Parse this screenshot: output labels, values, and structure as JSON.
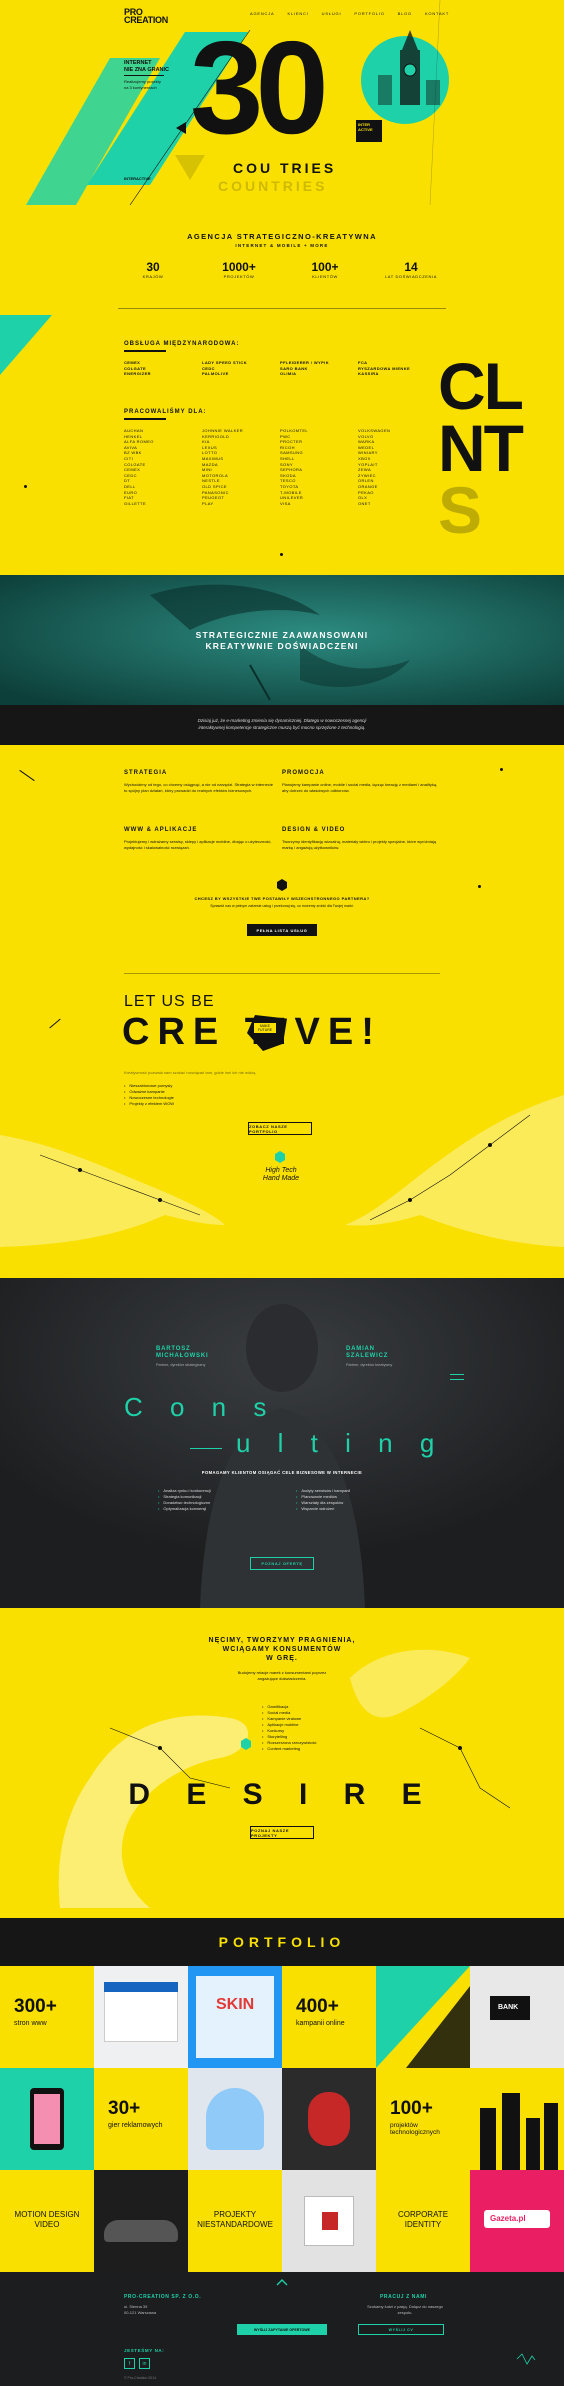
{
  "brand": {
    "logo_line1": "PRO",
    "logo_line2": "CREATION"
  },
  "nav": {
    "items": [
      "AGENCJA",
      "KLIENCI",
      "USŁUGI",
      "PORTFOLIO",
      "BLOG",
      "KONTAKT"
    ]
  },
  "hero": {
    "tagline_title_1": "INTERNET",
    "tagline_title_2": "NIE ZNA GRANIC",
    "tagline_text_1": "Realizujemy projekty",
    "tagline_text_2": "na 3 kontynentach",
    "big_number": "30",
    "word_top": "COU   TRIES",
    "word_bottom": "COUNTRIES",
    "word_rest": "NTRIES",
    "side_label": "INTERACTIVE",
    "badge": "INTER ACTIVE"
  },
  "stats": {
    "title": "AGENCJA STRATEGICZNO-KREATYWNA",
    "subtitle": "INTERNET & MOBILE + MORE",
    "items": [
      {
        "value": "30",
        "label": "KRAJÓW"
      },
      {
        "value": "1000+",
        "label": "PROJEKTÓW"
      },
      {
        "value": "100+",
        "label": "KLIENTÓW"
      },
      {
        "value": "14",
        "label": "LAT DOŚWIADCZENIA"
      }
    ]
  },
  "clients": {
    "international_title": "OBSŁUGA MIĘDZYNARODOWA:",
    "international": [
      [
        "CEMEX",
        "COLGATE",
        "ENERGIZER"
      ],
      [
        "LADY SPEED STICK",
        "CEDC",
        "PALMOLIVE"
      ],
      [
        "PFLEIDERER / WYPIK",
        "SARO BANK",
        "OLIMIA"
      ],
      [
        "FCA",
        "RYSZARDOWA MIENKE",
        "KASSIRA"
      ]
    ],
    "worked_title": "PRACOWALIŚMY DLA:",
    "columns": [
      [
        "AUCHAN",
        "HENKEL",
        "ALFA ROMEO",
        "AVIVA",
        "BZ WBK",
        "CITI",
        "COLGATE",
        "CEMEX",
        "CEDC",
        "DT",
        "DELL",
        "EURO",
        "FIAT",
        "GILLETTE"
      ],
      [
        "JOHNNIE WALKER",
        "KERRIGOLD",
        "KIA",
        "LEXUS",
        "LOTTO",
        "MAXIMUS",
        "MAZDA",
        "MINI",
        "MOTOROLA",
        "NESTLE",
        "OLD SPICE",
        "PANASONIC",
        "PEUGEOT",
        "PLAY"
      ],
      [
        "POLKOMTEL",
        "PWC",
        "PROCTER",
        "RICOH",
        "SAMSUNG",
        "SHELL",
        "SONY",
        "SEPHORA",
        "SKODA",
        "TESCO",
        "TOYOTA",
        "T-MOBILE",
        "UNILEVER",
        "VISA"
      ],
      [
        "VOLKSWAGEN",
        "VOLVO",
        "WARKA",
        "WEDEL",
        "WINIARY",
        "XBOX",
        "YOPLAIT",
        "ZEWA",
        "ZYWIEC",
        "ORLEN",
        "ORANGE",
        "PEKAO",
        "OLX",
        "ONET"
      ]
    ],
    "big_letters": [
      "CL",
      "NT",
      "S"
    ]
  },
  "band1": {
    "title_1": "STRATEGICZNIE ZAAWANSOWANI",
    "title_2": "KREATYWNIE DOŚWIADCZENI"
  },
  "intro": {
    "line_1": "Dzisiaj już, że e-marketing zmienia się dynamiczniej. Dlatego w nowoczesnej agencji",
    "line_2": "interaktywnej kompetencje strategiczne muszą być mocno sprzężone z technologią."
  },
  "services": {
    "items": [
      {
        "title": "STRATEGIA",
        "text": "Wychodzimy od tego, co chcemy osiągnąć, a nie od narzędzi. Strategia w internecie to spójny plan działań, który prowadzi do realnych efektów biznesowych."
      },
      {
        "title": "PROMOCJA",
        "text": "Planujemy kampanie online, mobile i social media, łącząc kreację z mediami i analityką, aby dotrzeć do właściwych odbiorców."
      },
      {
        "title": "WWW & APLIKACJE",
        "text": "Projektujemy i wdrażamy serwisy, sklepy i aplikacje mobilne, dbając o użyteczność, wydajność i skalowalność rozwiązań."
      },
      {
        "title": "DESIGN & VIDEO",
        "text": "Tworzymy identyfikację wizualną, materiały wideo i projekty specjalne, które wyróżniają markę i angażują użytkowników."
      }
    ],
    "note_title": "CHCESZ BY WSZYSTKIE TWE POSTAWIŁY WSZECHSTRONNEGO PARTNERA?",
    "note_text": "Sprawdź nas w pełnym zakresie usług i przekonaj się, co możemy zrobić dla Twojej marki.",
    "button": "PEŁNA LISTA USŁUG"
  },
  "creative": {
    "pre": "LET US BE",
    "word": "CRE   TIVE!",
    "sticker": "MAKE FUTURE",
    "intro": "Kreatywność pozwala nam szukać rozwiązań tam, gdzie inni ich nie widzą.",
    "bullets": [
      "Nieszablonowe pomysły",
      "Odważne kampanie",
      "Nowoczesne technologie",
      "Projekty z efektem WOW"
    ],
    "button": "ZOBACZ NASZE PORTFOLIO",
    "caption_1": "High Tech",
    "caption_2": "Hand Made"
  },
  "consult": {
    "person1_name_1": "BARTOSZ",
    "person1_name_2": "MICHAŁOWSKI",
    "person1_role": "Partner, dyrektor strategiczny",
    "person2_name_1": "DAMIAN",
    "person2_name_2": "SZALEWICZ",
    "person2_role": "Partner, dyrektor kreatywny",
    "word_1": "C o n s",
    "word_2": "u l t i n g",
    "lead": "POMAGAMY KLIENTOM OSIĄGAĆ CELE BIZNESOWE W INTERNECIE",
    "bullets_left": [
      "Analiza rynku i konkurencji",
      "Strategia komunikacji",
      "Doradztwo technologiczne",
      "Optymalizacja konwersji"
    ],
    "bullets_right": [
      "Audyty serwisów i kampanii",
      "Planowanie mediów",
      "Warsztaty dla zespołów",
      "Wsparcie wdrożeń"
    ],
    "button": "POZNAJ OFERTĘ"
  },
  "desire": {
    "title_1": "NĘCIMY, TWORZYMY PRAGNIENIA,",
    "title_2": "WCIĄGAMY KONSUMENTÓW",
    "title_3": "W GRĘ.",
    "text": "Budujemy relacje marek z konsumentami poprzez angażujące doświadczenia.",
    "bullets": [
      "Gamifikacja",
      "Social media",
      "Kampanie viralowe",
      "Aplikacje mobilne",
      "Konkursy",
      "Storytelling",
      "Rozszerzona rzeczywistość",
      "Content marketing"
    ],
    "word": "D E S I R E",
    "button": "POZNAJ NASZE PROJEKTY"
  },
  "portfolio": {
    "title": "PORTFOLIO",
    "tiles": [
      {
        "value": "300+",
        "label": "stron www"
      },
      {
        "value": "400+",
        "label": "kampanii online"
      },
      {
        "value": "30+",
        "label": "gier reklamowych"
      },
      {
        "value": "100+",
        "label": "projektów technologicznych"
      },
      {
        "label_1": "MOTION DESIGN",
        "label_2": "VIDEO"
      },
      {
        "label_1": "PROJEKTY",
        "label_2": "NIESTANDARDOWE"
      },
      {
        "label_1": "CORPORATE",
        "label_2": "IDENTITY"
      }
    ],
    "thumb_text": {
      "skin": "SKIN",
      "bank": "BANK",
      "gazeta": "Gazeta.pl"
    }
  },
  "footer": {
    "company": "PRO-CREATION SP. Z O.O.",
    "address_1": "ul. Sienna 39",
    "address_2": "00-121 Warszawa",
    "jobs_title": "PRACUJ Z NAMI",
    "jobs_text": "Szukamy ludzi z pasją. Dołącz do naszego zespołu.",
    "btn_contact": "WYŚLIJ ZAPYTANIE OFERTOWE",
    "btn_jobs": "WYŚLIJ CV",
    "social_title": "JESTEŚMY NA:",
    "social": [
      "f",
      "in"
    ],
    "copyright": "© Pro-Creation 2014"
  },
  "colors": {
    "yellow": "#f9e000",
    "teal": "#1fd1a8",
    "dark": "#161616"
  }
}
